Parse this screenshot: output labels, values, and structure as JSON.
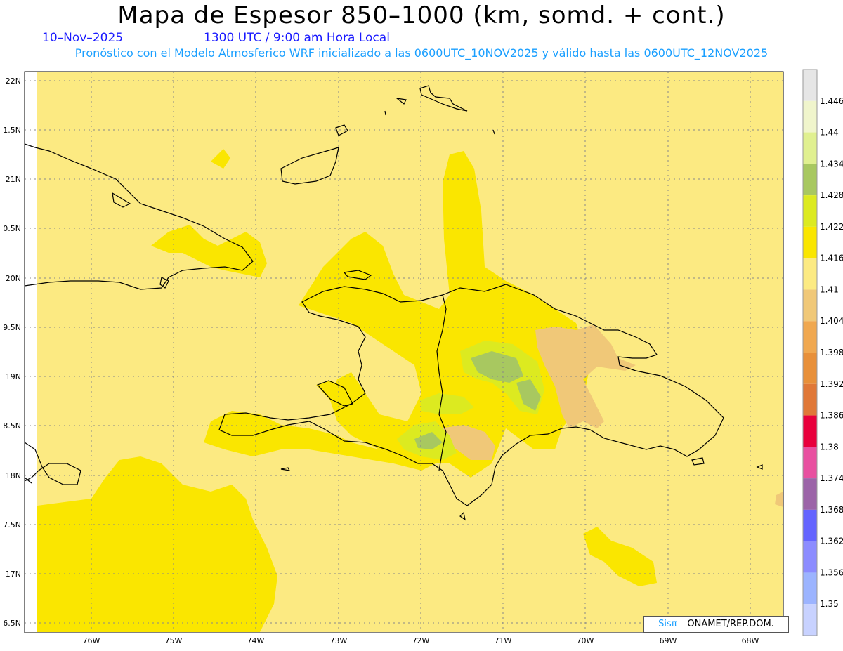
{
  "header": {
    "title": "Mapa de Espesor 850–1000 (km, somd. + cont.)",
    "date": "10–Nov–2025",
    "time": "1300 UTC / 9:00 am Hora Local",
    "forecast": "Pronóstico con el Modelo Atmosferico WRF inicializado a las 0600UTC_10NOV2025 y válido hasta las  0600UTC_12NOV2025"
  },
  "map": {
    "lat_labels": [
      "22N",
      "1.5N",
      "21N",
      "0.5N",
      "20N",
      "9.5N",
      "19N",
      "8.5N",
      "18N",
      "7.5N",
      "17N",
      "6.5N"
    ],
    "lon_labels": [
      "76W",
      "75W",
      "74W",
      "73W",
      "72W",
      "71W",
      "70W",
      "69W",
      "68W"
    ]
  },
  "colorbar": {
    "labels": [
      "1.446",
      "1.44",
      "1.434",
      "1.428",
      "1.422",
      "1.416",
      "1.41",
      "1.404",
      "1.398",
      "1.392",
      "1.386",
      "1.38",
      "1.374",
      "1.368",
      "1.362",
      "1.356",
      "1.35"
    ],
    "colors": [
      "#e6e6e6",
      "#f0f5cc",
      "#e0f090",
      "#a8c860",
      "#dcea20",
      "#fae600",
      "#fcea82",
      "#f0c878",
      "#f0a850",
      "#e8903a",
      "#e07838",
      "#e8003c",
      "#e850a0",
      "#9c64a8",
      "#6464ff",
      "#8c8cff",
      "#9cb4ff",
      "#c8d2ff"
    ]
  },
  "credit": {
    "brand": "Sisπ",
    "text": "– ONAMET/REP.DOM."
  }
}
